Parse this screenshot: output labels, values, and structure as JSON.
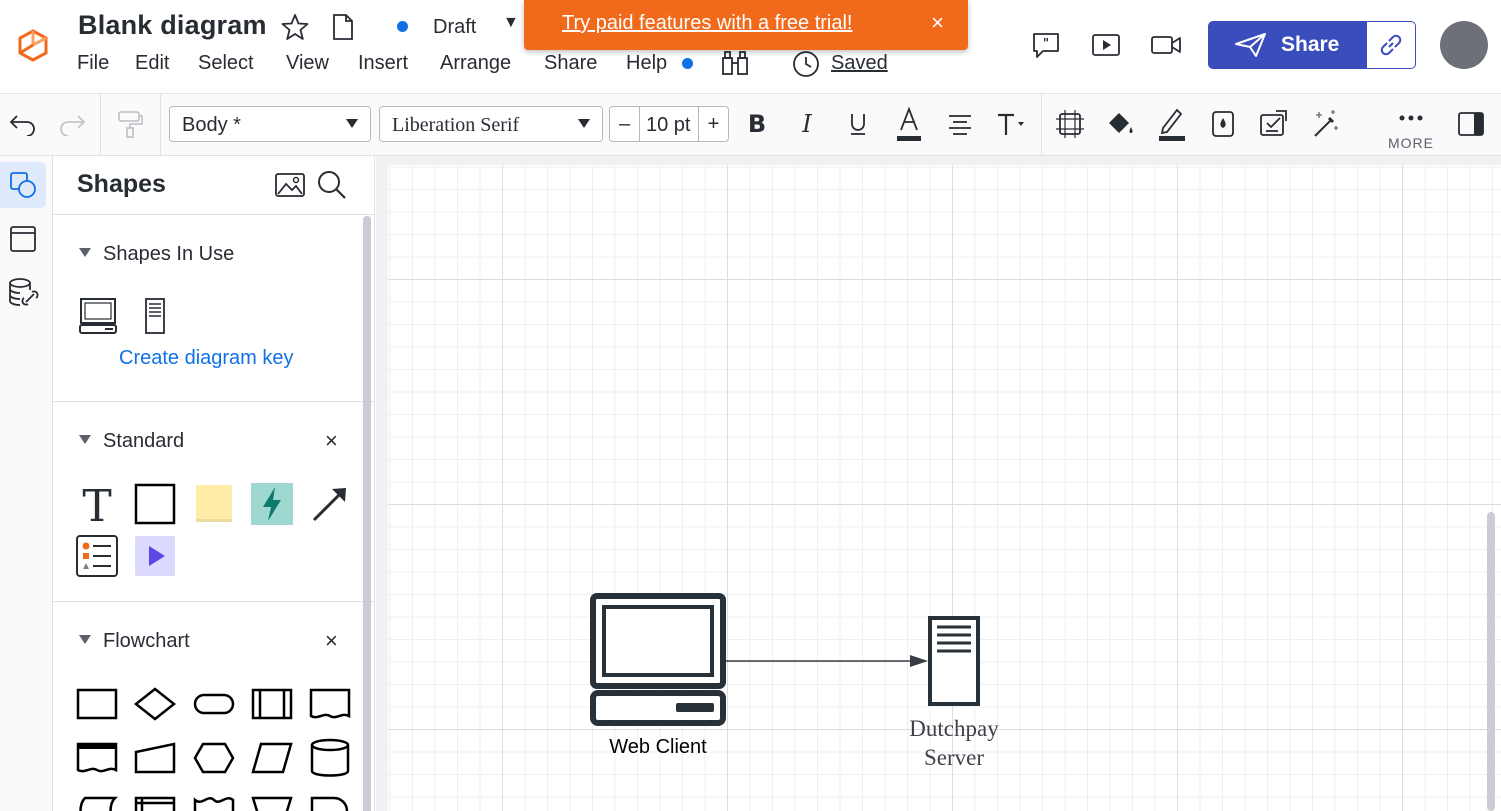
{
  "header": {
    "title": "Blank diagram",
    "status": "Draft",
    "status_color": "#1071e5",
    "saved": "Saved",
    "menu": [
      "File",
      "Edit",
      "Select",
      "View",
      "Insert",
      "Arrange",
      "Share",
      "Help"
    ],
    "banner": {
      "text": "Try paid features with a free trial!",
      "color": "#f16a1c",
      "close": "×"
    },
    "share_label": "Share",
    "accent": "#3a4dbd"
  },
  "toolbar": {
    "style_select": "Body *",
    "font_select": "Liberation Serif",
    "font_size": "10 pt",
    "minus": "–",
    "plus": "+",
    "more": "MORE"
  },
  "panel": {
    "title": "Shapes",
    "sections": [
      {
        "label": "Shapes In Use",
        "link": "Create diagram key"
      },
      {
        "label": "Standard",
        "close": "×"
      },
      {
        "label": "Flowchart",
        "close": "×"
      }
    ]
  },
  "canvas": {
    "shapes": [
      {
        "name": "web-client",
        "icon": "laptop-icon",
        "label": "Web Client"
      },
      {
        "name": "dutchpay-server",
        "icon": "server-icon",
        "label_line1": "Dutchpay",
        "label_line2": "Server"
      }
    ],
    "connector": {
      "from": "Web Client",
      "to": "Dutchpay Server"
    }
  }
}
